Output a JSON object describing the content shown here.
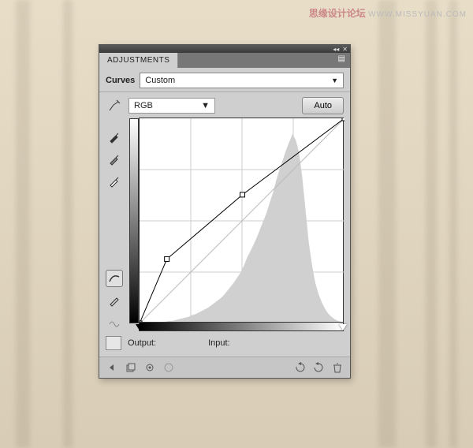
{
  "watermark": {
    "cn": "思缘设计论坛",
    "url": "WWW.MISSYUAN.COM"
  },
  "panel": {
    "tab": "ADJUSTMENTS",
    "title": "Curves",
    "preset": "Custom",
    "channel": "RGB",
    "auto": "Auto",
    "output_label": "Output:",
    "input_label": "Input:"
  },
  "chart_data": {
    "type": "line",
    "title": "Curves",
    "xlabel": "Input",
    "ylabel": "Output",
    "xlim": [
      0,
      255
    ],
    "ylim": [
      0,
      255
    ],
    "curve_points": [
      {
        "x": 0,
        "y": 0
      },
      {
        "x": 34,
        "y": 80
      },
      {
        "x": 128,
        "y": 160
      },
      {
        "x": 255,
        "y": 255
      }
    ],
    "histogram": [
      0,
      0,
      0,
      0,
      0,
      1,
      1,
      2,
      2,
      3,
      3,
      4,
      5,
      6,
      7,
      8,
      10,
      11,
      13,
      15,
      17,
      19,
      22,
      25,
      28,
      31,
      35,
      40,
      45,
      50,
      56,
      62,
      70,
      80,
      88,
      96,
      105,
      115,
      125,
      135,
      148,
      160,
      175,
      188,
      200,
      212,
      222,
      232,
      225,
      210,
      180,
      140,
      100,
      72,
      50,
      36,
      26,
      18,
      12,
      8,
      5,
      3,
      2,
      1
    ]
  }
}
